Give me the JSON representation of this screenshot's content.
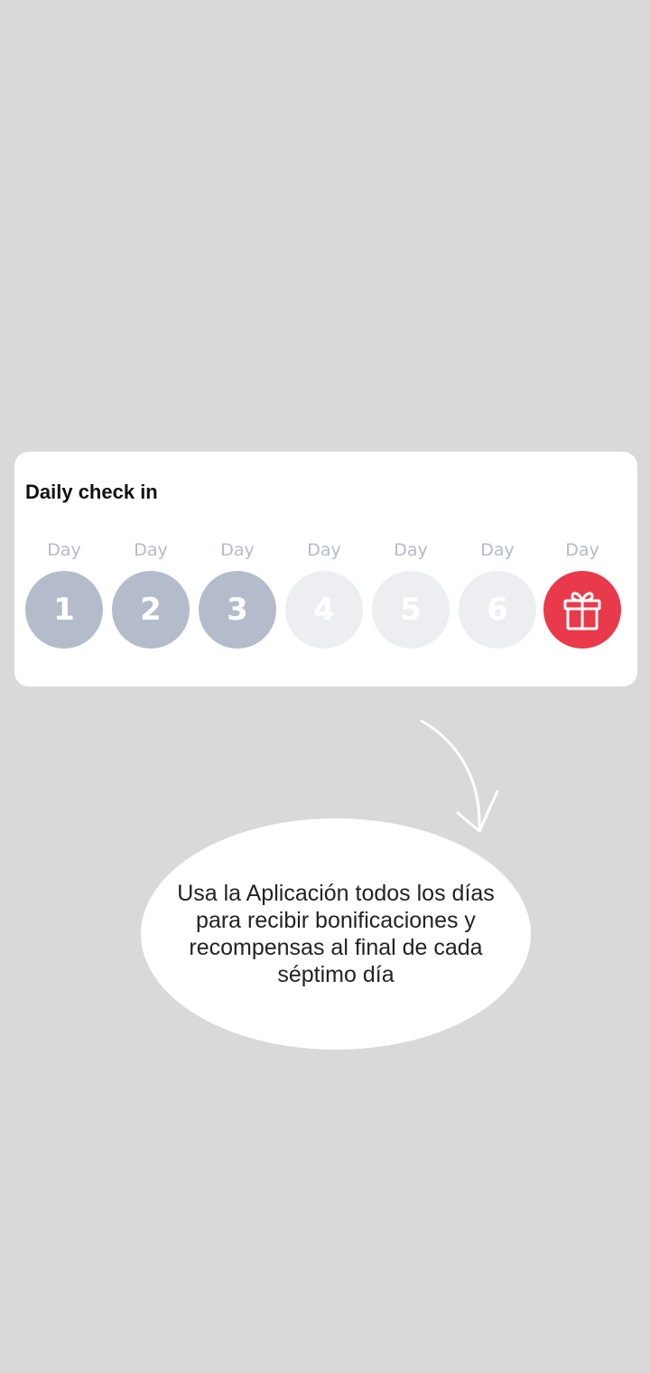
{
  "checkin": {
    "title": "Daily check in",
    "days": [
      {
        "label": "Day",
        "number": "1",
        "state": "checked"
      },
      {
        "label": "Day",
        "number": "2",
        "state": "checked"
      },
      {
        "label": "Day",
        "number": "3",
        "state": "checked"
      },
      {
        "label": "Day",
        "number": "4",
        "state": "pending"
      },
      {
        "label": "Day",
        "number": "5",
        "state": "pending"
      },
      {
        "label": "Day",
        "number": "6",
        "state": "pending"
      },
      {
        "label": "Day",
        "icon": "gift-icon",
        "state": "reward"
      }
    ],
    "colors": {
      "checked": "#b4bccb",
      "pending": "#edeef2",
      "reward": "#e83a4a"
    }
  },
  "tooltip": {
    "text": "Usa la Aplicación todos los días para recibir bonificaciones y recompensas al final de cada séptimo día",
    "arrow_icon": "curved-arrow-icon"
  }
}
